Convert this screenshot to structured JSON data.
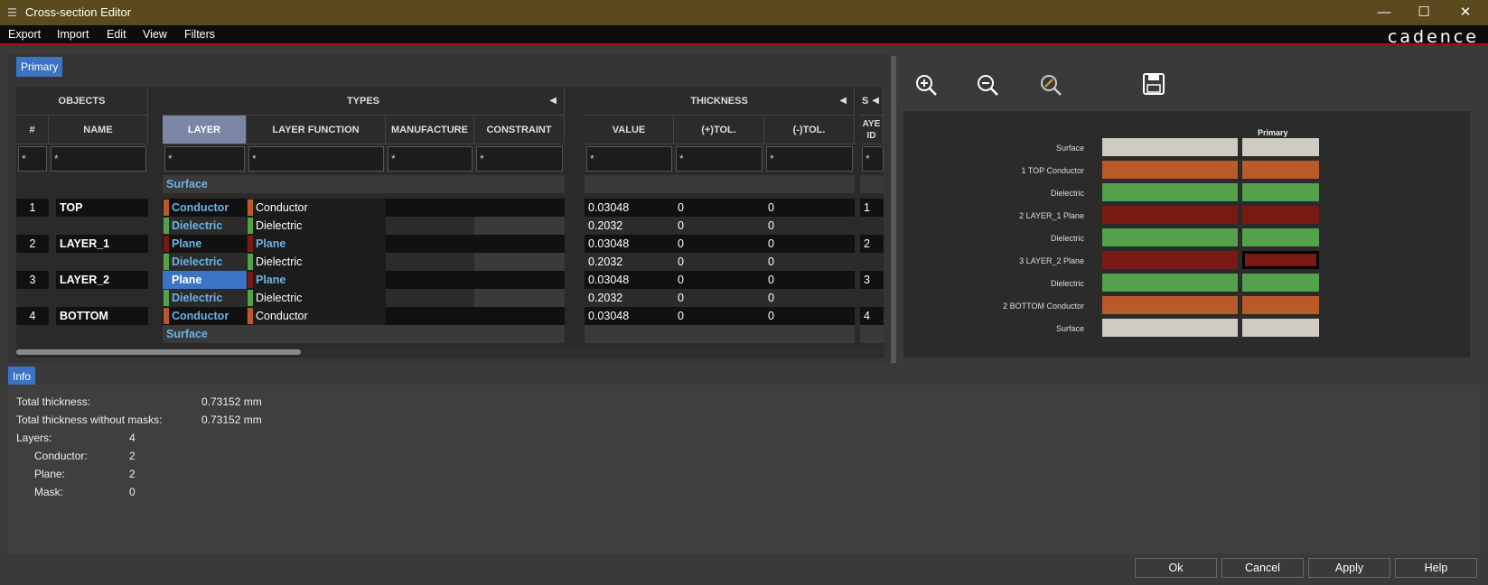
{
  "window": {
    "title": "Cross-section Editor"
  },
  "menu": [
    "Export",
    "Import",
    "Edit",
    "View",
    "Filters"
  ],
  "brand": "cadence",
  "tabs": {
    "primary": "Primary",
    "info": "Info"
  },
  "groups": {
    "objects": "OBJECTS",
    "types": "TYPES",
    "thickness": "THICKNESS",
    "s": "S"
  },
  "columns": {
    "num": "#",
    "name": "NAME",
    "layer": "LAYER",
    "layer_function": "LAYER FUNCTION",
    "manufacture": "MANUFACTURE",
    "constraint": "CONSTRAINT",
    "value": "VALUE",
    "ptol": "(+)TOL.",
    "ntol": "(-)TOL.",
    "layer_id": "AYE ID"
  },
  "filter": "*",
  "colors": {
    "conductor": "#b85a2a",
    "dielectric": "#55a04a",
    "plane": "#7a1a14",
    "surface": "#cfcbc2",
    "top_swatch": "#7de36a",
    "bottom_swatch": "#ffe84a",
    "layer_swatch": "#4d7a3f",
    "selected": "#3b73c5"
  },
  "rows": [
    {
      "num": "",
      "name": "",
      "layer": "Surface",
      "func": "",
      "value": "",
      "ptol": "",
      "ntol": "",
      "id": "",
      "kind": "surface"
    },
    {
      "num": "1",
      "name": "TOP",
      "layer": "Conductor",
      "func": "Conductor",
      "value": "0.03048",
      "ptol": "0",
      "ntol": "0",
      "id": "1",
      "kind": "conductor",
      "nameSwatch": "#7de36a"
    },
    {
      "num": "",
      "name": "",
      "layer": "Dielectric",
      "func": "Dielectric",
      "value": "0.2032",
      "ptol": "0",
      "ntol": "0",
      "id": "",
      "kind": "dielectric"
    },
    {
      "num": "2",
      "name": "LAYER_1",
      "layer": "Plane",
      "func": "Plane",
      "value": "0.03048",
      "ptol": "0",
      "ntol": "0",
      "id": "2",
      "kind": "plane",
      "nameSwatch": "#4d7a3f"
    },
    {
      "num": "",
      "name": "",
      "layer": "Dielectric",
      "func": "Dielectric",
      "value": "0.2032",
      "ptol": "0",
      "ntol": "0",
      "id": "",
      "kind": "dielectric"
    },
    {
      "num": "3",
      "name": "LAYER_2",
      "layer": "Plane",
      "func": "Plane",
      "value": "0.03048",
      "ptol": "0",
      "ntol": "0",
      "id": "3",
      "kind": "plane",
      "nameSwatch": "#4d7a3f",
      "selected": true
    },
    {
      "num": "",
      "name": "",
      "layer": "Dielectric",
      "func": "Dielectric",
      "value": "0.2032",
      "ptol": "0",
      "ntol": "0",
      "id": "",
      "kind": "dielectric"
    },
    {
      "num": "4",
      "name": "BOTTOM",
      "layer": "Conductor",
      "func": "Conductor",
      "value": "0.03048",
      "ptol": "0",
      "ntol": "0",
      "id": "4",
      "kind": "conductor",
      "nameSwatch": "#ffe84a"
    },
    {
      "num": "",
      "name": "",
      "layer": "Surface",
      "func": "",
      "value": "",
      "ptol": "",
      "ntol": "",
      "id": "",
      "kind": "surface"
    }
  ],
  "toolbar": {
    "zoom_in": "zoom-in-icon",
    "zoom_out": "zoom-out-icon",
    "zoom_fit": "zoom-fit-icon",
    "save": "save-icon"
  },
  "preview": {
    "column_title": "Primary",
    "rows": [
      {
        "label": "Surface",
        "kind": "surface"
      },
      {
        "label": "1    TOP Conductor",
        "kind": "conductor"
      },
      {
        "label": "Dielectric",
        "kind": "dielectric"
      },
      {
        "label": "2    LAYER_1 Plane",
        "kind": "plane"
      },
      {
        "label": "Dielectric",
        "kind": "dielectric"
      },
      {
        "label": "3    LAYER_2 Plane",
        "kind": "plane",
        "selected": true
      },
      {
        "label": "Dielectric",
        "kind": "dielectric"
      },
      {
        "label": "2    BOTTOM Conductor",
        "kind": "conductor"
      },
      {
        "label": "Surface",
        "kind": "surface"
      }
    ]
  },
  "info": {
    "total_thickness_label": "Total thickness:",
    "total_thickness": "0.73152 mm",
    "total_nomask_label": "Total thickness without masks:",
    "total_nomask": "0.73152 mm",
    "layers_label": "Layers:",
    "layers": "4",
    "conductor_label": "Conductor:",
    "conductor": "2",
    "plane_label": "Plane:",
    "plane": "2",
    "mask_label": "Mask:",
    "mask": "0"
  },
  "buttons": {
    "ok": "Ok",
    "cancel": "Cancel",
    "apply": "Apply",
    "help": "Help"
  }
}
